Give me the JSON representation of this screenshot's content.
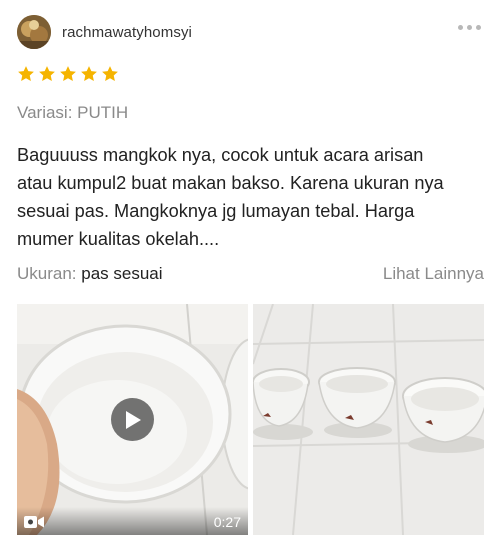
{
  "review": {
    "username": "rachmawatyhomsyi",
    "rating": 5,
    "rating_color": "#f5b400",
    "variant_text": "Variasi: PUTIH",
    "text_lines": [
      "Baguuuss mangkok nya, cocok untuk acara arisan",
      "atau kumpul2 buat makan bakso. Karena ukuran nya",
      "sesuai pas. Mangkoknya jg lumayan tebal. Harga",
      "mumer kualitas okelah...."
    ],
    "size_label": "Ukuran:",
    "size_value": "pas sesuai",
    "see_more": "Lihat Lainnya",
    "video_duration": "0:27",
    "icons": {
      "more": "more-dots-icon",
      "star": "star-icon",
      "play": "play-icon",
      "camera": "video-camera-icon"
    }
  }
}
